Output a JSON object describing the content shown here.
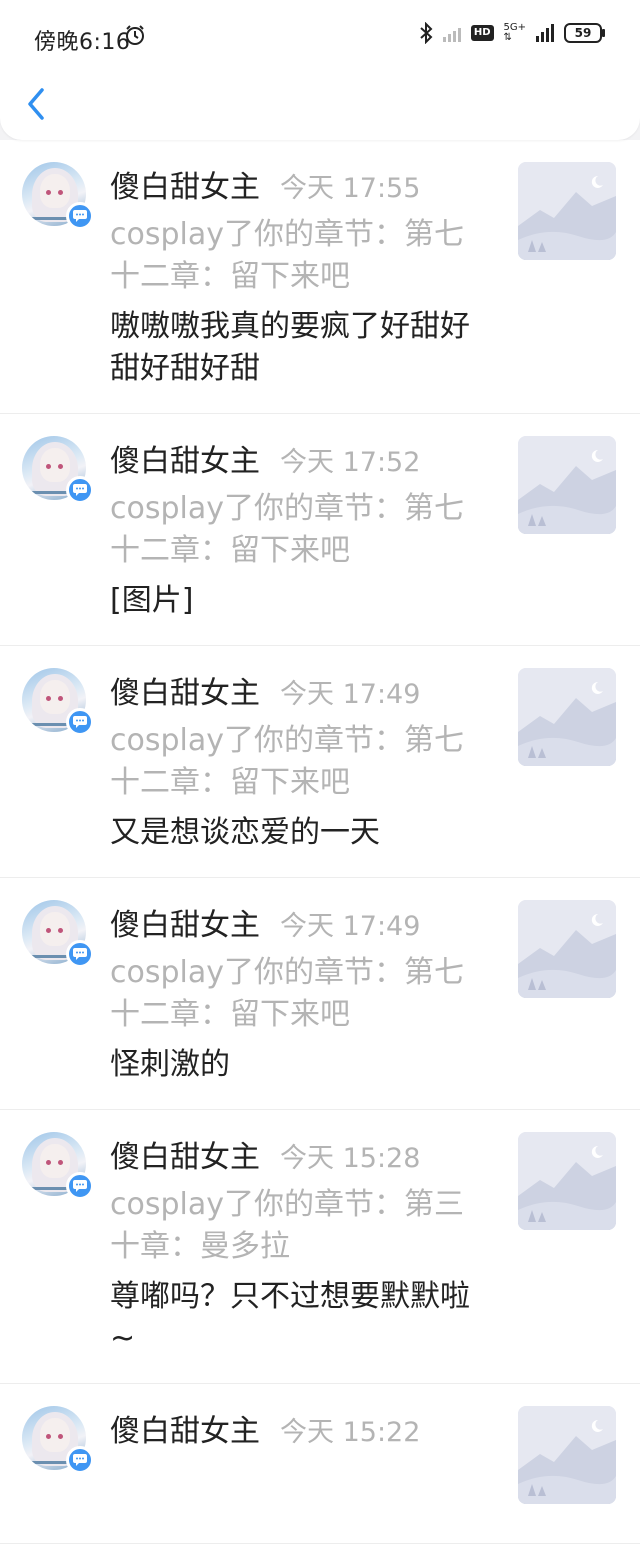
{
  "status_bar": {
    "time": "傍晚6:16",
    "network": "5G+",
    "hd": "HD",
    "battery": "59"
  },
  "header": {
    "back_icon": "chevron-left-icon"
  },
  "notifications": [
    {
      "user": "傻白甜女主",
      "time": "今天 17:55",
      "reference": "cosplay了你的章节：第七十二章：留下来吧",
      "message": "嗷嗷嗷我真的要疯了好甜好甜好甜好甜"
    },
    {
      "user": "傻白甜女主",
      "time": "今天 17:52",
      "reference": "cosplay了你的章节：第七十二章：留下来吧",
      "message": "[图片]"
    },
    {
      "user": "傻白甜女主",
      "time": "今天 17:49",
      "reference": "cosplay了你的章节：第七十二章：留下来吧",
      "message": "又是想谈恋爱的一天"
    },
    {
      "user": "傻白甜女主",
      "time": "今天 17:49",
      "reference": "cosplay了你的章节：第七十二章：留下来吧",
      "message": "怪刺激的"
    },
    {
      "user": "傻白甜女主",
      "time": "今天 15:28",
      "reference": "cosplay了你的章节：第三十章：曼多拉",
      "message": "尊嘟吗？只不过想要默默啦 ~"
    },
    {
      "user": "傻白甜女主",
      "time": "今天 15:22",
      "reference": "",
      "message": ""
    }
  ]
}
